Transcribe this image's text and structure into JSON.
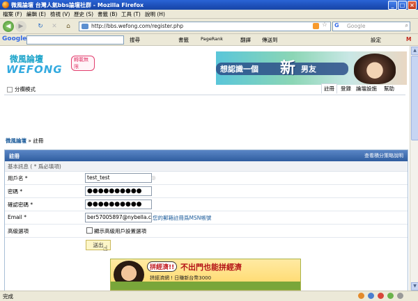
{
  "window": {
    "title": "微風論壇 台灣人氣bbs論壇社群 - Mozilla Firefox"
  },
  "menu": [
    "檔案 (F)",
    "編輯 (E)",
    "檢視 (V)",
    "歷史 (S)",
    "書籤 (B)",
    "工具 (T)",
    "說明 (H)"
  ],
  "nav": {
    "url": "http://bbs.wefong.com/register.php",
    "search_placeholder": "Google",
    "search_engine": "G"
  },
  "googlebar": {
    "logo": "Google",
    "items": [
      "搜尋",
      "書籤",
      "PageRank",
      "翻譯",
      "傳送到",
      "設定",
      "M"
    ]
  },
  "site": {
    "logo_cn": "微風論壇",
    "logo_en": "WEFONG",
    "logo_tag": "轉載無限",
    "banner_text": "想認識一個",
    "banner_big": "新",
    "banner_suffix": "男友"
  },
  "subnav": {
    "left": "分欄模式",
    "links": [
      "註冊",
      "登錄",
      "論壇設施",
      "幫助"
    ]
  },
  "breadcrumb": {
    "home": "微風論壇",
    "sep": " » ",
    "current": "註冊"
  },
  "form": {
    "title": "註冊",
    "help_link": "查看積分策略說明",
    "section": "基本訊息 ( * 爲必填項)",
    "fields": [
      {
        "label": "用戶名 *",
        "value": "test_test"
      },
      {
        "label": "密碼 *",
        "value": "●●●●●●●●●●"
      },
      {
        "label": "確認密碼 *",
        "value": "●●●●●●●●●●"
      },
      {
        "label": "Email *",
        "value": "ber57005897@nybella.com",
        "hint": "您的郵箱註冊爲MSN帳號"
      }
    ],
    "advanced_label": "高級選項",
    "advanced_checkbox": "顯示高級用戶設置選項",
    "submit": "送出"
  },
  "ad": {
    "bubble": "拼經濟!!",
    "headline": "不出門也能拼經濟",
    "sub": "拼經濟網 !  日賺新台幣3000"
  },
  "status": {
    "text": "完成"
  }
}
